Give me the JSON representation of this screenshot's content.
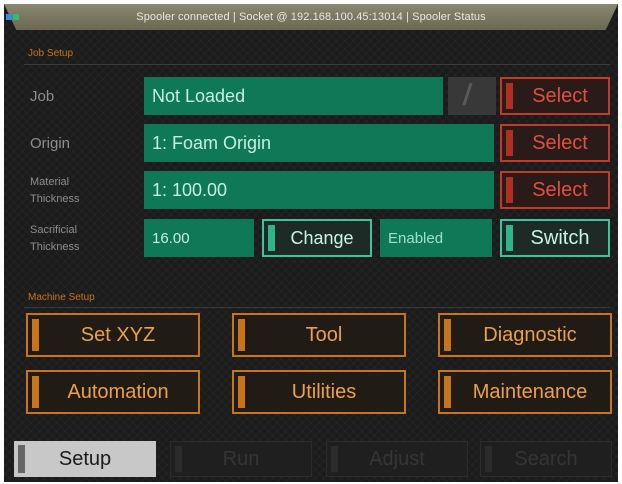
{
  "status_bar": {
    "text": "Spooler connected | Socket @ 192.168.100.45:13014 | Spooler Status",
    "led_colors": [
      "#3a8ae0",
      "#2bbf7a"
    ]
  },
  "job_setup": {
    "title": "Job Setup",
    "rows": {
      "job": {
        "label": "Job",
        "value": "Not Loaded",
        "select_label": "Select"
      },
      "origin": {
        "label": "Origin",
        "value": "1: Foam Origin",
        "select_label": "Select"
      },
      "material": {
        "label_line1": "Material",
        "label_line2": "Thickness",
        "value": "1: 100.00",
        "select_label": "Select"
      },
      "sacrificial": {
        "label_line1": "Sacrificial",
        "label_line2": "Thickness",
        "value": "16.00",
        "change_label": "Change",
        "status": "Enabled",
        "switch_label": "Switch"
      }
    }
  },
  "machine_setup": {
    "title": "Machine Setup",
    "buttons": {
      "set_xyz": "Set XYZ",
      "tool": "Tool",
      "diagnostic": "Diagnostic",
      "automation": "Automation",
      "utilities": "Utilities",
      "maintenance": "Maintenance"
    }
  },
  "tabs": {
    "setup": "Setup",
    "run": "Run",
    "adjust": "Adjust",
    "search": "Search",
    "active": "Setup"
  },
  "colors": {
    "accent_orange": "#c8741c",
    "field_green": "#0e7857",
    "select_red": "#c43a2a",
    "switch_teal": "#3ac59a",
    "background": "#1b1b1b"
  }
}
